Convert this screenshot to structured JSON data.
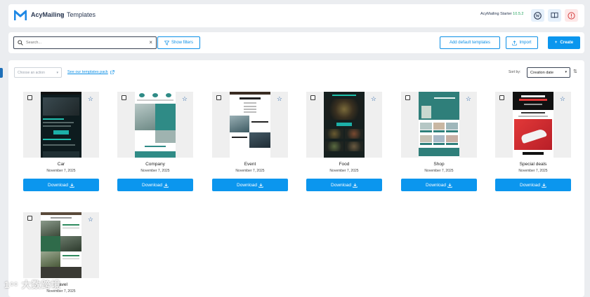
{
  "header": {
    "app_name": "AcyMailing",
    "separator": ">",
    "page": "Templates",
    "version_label": "AcyMailing Starter",
    "version_number": "10.5.2"
  },
  "toolbar": {
    "search_placeholder": "Search...",
    "clear_symbol": "×",
    "show_filters": "Show filters",
    "add_default": "Add default templates",
    "import": "Import",
    "create": "Create",
    "create_prefix": "+"
  },
  "list": {
    "bulk_placeholder": "Choose an action",
    "pack_link": "See our templates pack",
    "sort_label": "Sort by:",
    "sort_value": "Creation date"
  },
  "templates": [
    {
      "name": "Car",
      "date": "November 7, 2025",
      "download": "Download"
    },
    {
      "name": "Company",
      "date": "November 7, 2025",
      "download": "Download"
    },
    {
      "name": "Event",
      "date": "November 7, 2025",
      "download": "Download"
    },
    {
      "name": "Food",
      "date": "November 7, 2025",
      "download": "Download"
    },
    {
      "name": "Shop",
      "date": "November 7, 2025",
      "download": "Download"
    },
    {
      "name": "Special deals",
      "date": "November 7, 2025",
      "download": "Download"
    },
    {
      "name": "Travel",
      "date": "November 7, 2025",
      "download": "Download"
    }
  ],
  "watermark": "大数跨境",
  "colors": {
    "accent": "#0b96ee",
    "brand_dark": "#2a3852"
  }
}
